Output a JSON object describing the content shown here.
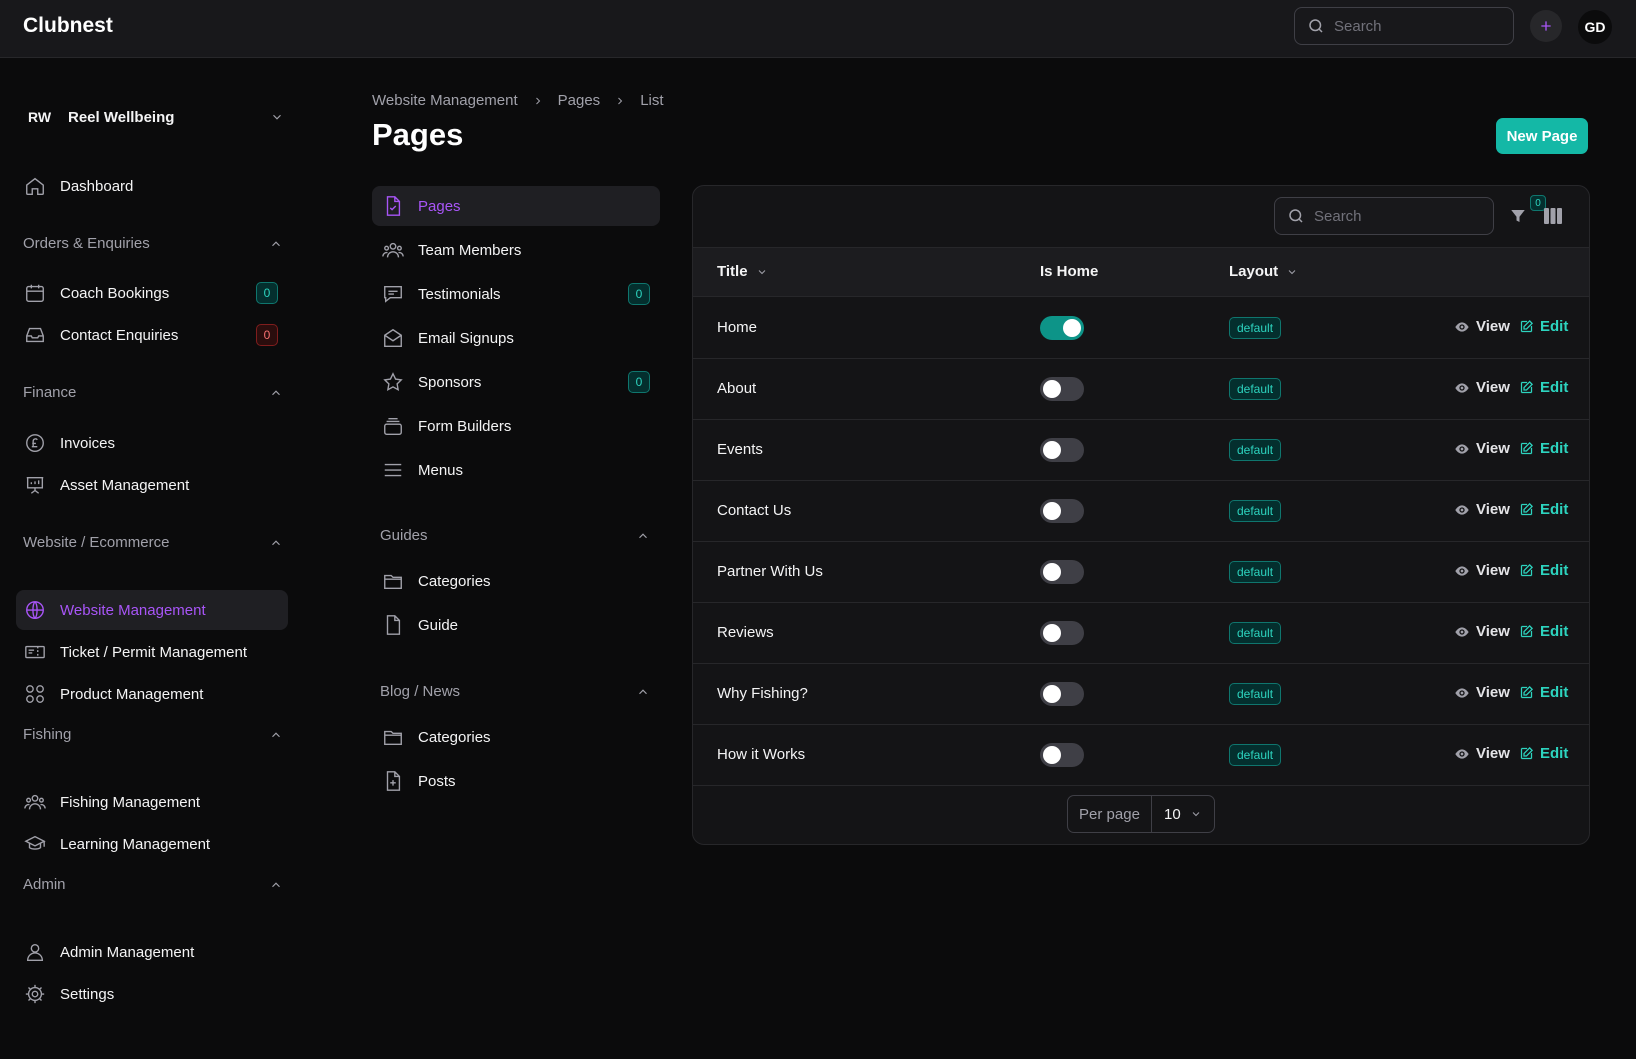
{
  "app": {
    "brand": "Clubnest",
    "avatar": "GD",
    "search_placeholder": "Search"
  },
  "tenant": {
    "initials": "RW",
    "name": "Reel Wellbeing"
  },
  "sidebar": {
    "dashboard": "Dashboard",
    "groups": [
      {
        "label": "Orders & Enquiries",
        "items": [
          {
            "label": "Coach Bookings",
            "badge": "0",
            "icon": "calendar-icon"
          },
          {
            "label": "Contact Enquiries",
            "badge": "0",
            "icon": "inbox-icon"
          }
        ]
      },
      {
        "label": "Finance",
        "items": [
          {
            "label": "Invoices",
            "icon": "pound-icon"
          },
          {
            "label": "Asset Management",
            "icon": "presentation-chart-icon"
          }
        ]
      },
      {
        "label": "Website / Ecommerce",
        "items": [
          {
            "label": "Website Management",
            "icon": "globe-icon",
            "active": true
          },
          {
            "label": "Ticket / Permit Management",
            "icon": "ticket-icon"
          },
          {
            "label": "Product Management",
            "icon": "squares-icon"
          }
        ]
      },
      {
        "label": "Fishing",
        "items": [
          {
            "label": "Fishing Management",
            "icon": "users-group-icon"
          },
          {
            "label": "Learning Management",
            "icon": "academic-cap-icon"
          }
        ]
      },
      {
        "label": "Admin",
        "items": [
          {
            "label": "Admin Management",
            "icon": "user-icon"
          },
          {
            "label": "Settings",
            "icon": "cog-icon"
          }
        ]
      }
    ]
  },
  "breadcrumb": [
    "Website Management",
    "Pages",
    "List"
  ],
  "page_title": "Pages",
  "new_button": "New Page",
  "subnav": {
    "items": [
      {
        "label": "Pages",
        "active": true
      },
      {
        "label": "Team Members"
      },
      {
        "label": "Testimonials",
        "badge": "0"
      },
      {
        "label": "Email Signups"
      },
      {
        "label": "Sponsors",
        "badge": "0"
      },
      {
        "label": "Form Builders"
      },
      {
        "label": "Menus"
      }
    ],
    "guides": {
      "label": "Guides",
      "items": [
        "Categories",
        "Guide"
      ]
    },
    "blog": {
      "label": "Blog / News",
      "items": [
        "Categories",
        "Posts"
      ]
    }
  },
  "table": {
    "search_placeholder": "Search",
    "filter_count": "0",
    "columns": {
      "title": "Title",
      "is_home": "Is Home",
      "layout": "Layout"
    },
    "actions": {
      "view": "View",
      "edit": "Edit"
    },
    "rows": [
      {
        "title": "Home",
        "is_home": true,
        "layout": "default"
      },
      {
        "title": "About",
        "is_home": false,
        "layout": "default"
      },
      {
        "title": "Events",
        "is_home": false,
        "layout": "default"
      },
      {
        "title": "Contact Us",
        "is_home": false,
        "layout": "default"
      },
      {
        "title": "Partner With Us",
        "is_home": false,
        "layout": "default"
      },
      {
        "title": "Reviews",
        "is_home": false,
        "layout": "default"
      },
      {
        "title": "Why Fishing?",
        "is_home": false,
        "layout": "default"
      },
      {
        "title": "How it Works",
        "is_home": false,
        "layout": "default"
      }
    ],
    "pagination": {
      "label": "Per page",
      "value": "10"
    }
  },
  "colors": {
    "accent": "#14b8a6",
    "active": "#a855f7",
    "danger": "#f87171"
  }
}
